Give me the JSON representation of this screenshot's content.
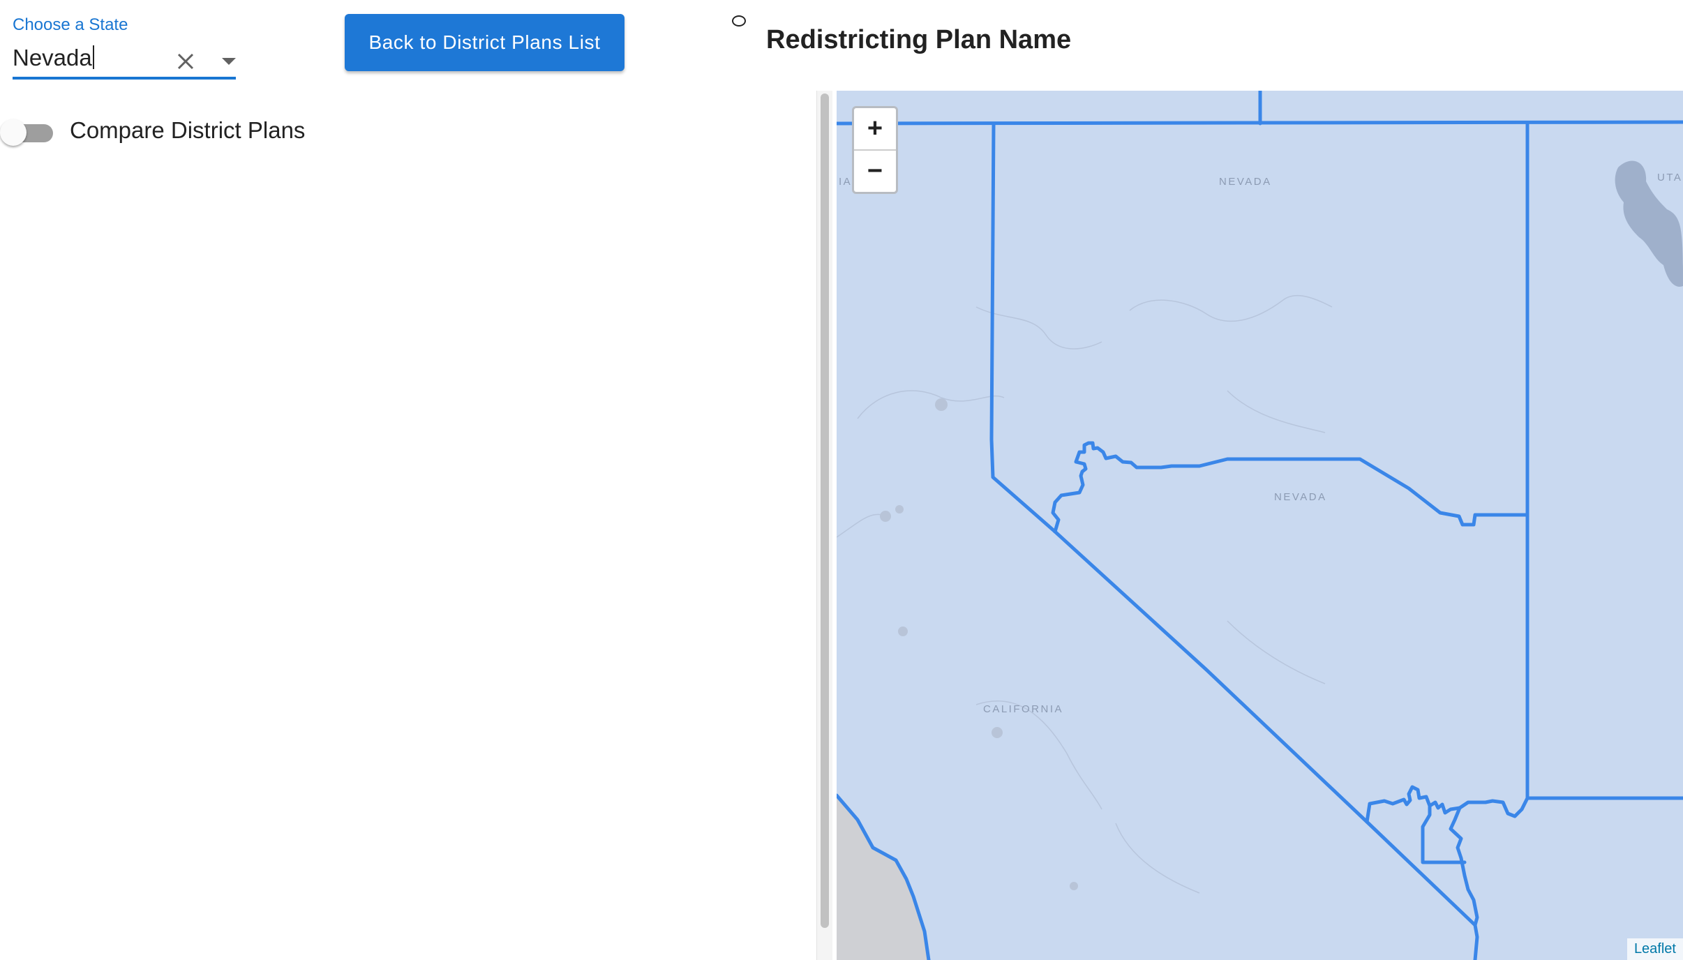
{
  "state_select": {
    "label": "Choose a State",
    "value": "Nevada",
    "accent_color": "#1976d2"
  },
  "back_button": {
    "label": "Back to District Plans List",
    "color": "#1e78d6"
  },
  "compare_toggle": {
    "label": "Compare District Plans",
    "checked": false
  },
  "plan_title": "Redistricting Plan Name",
  "map": {
    "labels": {
      "nevada_north": "NEVADA",
      "nevada_south": "NEVADA",
      "california": "CALIFORNIA",
      "utah": "UTAH",
      "left_edge": "IA"
    },
    "zoom_in": "+",
    "zoom_out": "−",
    "attribution": "Leaflet",
    "district_color": "#3a86e8",
    "fill_color": "#c9d9f0"
  }
}
